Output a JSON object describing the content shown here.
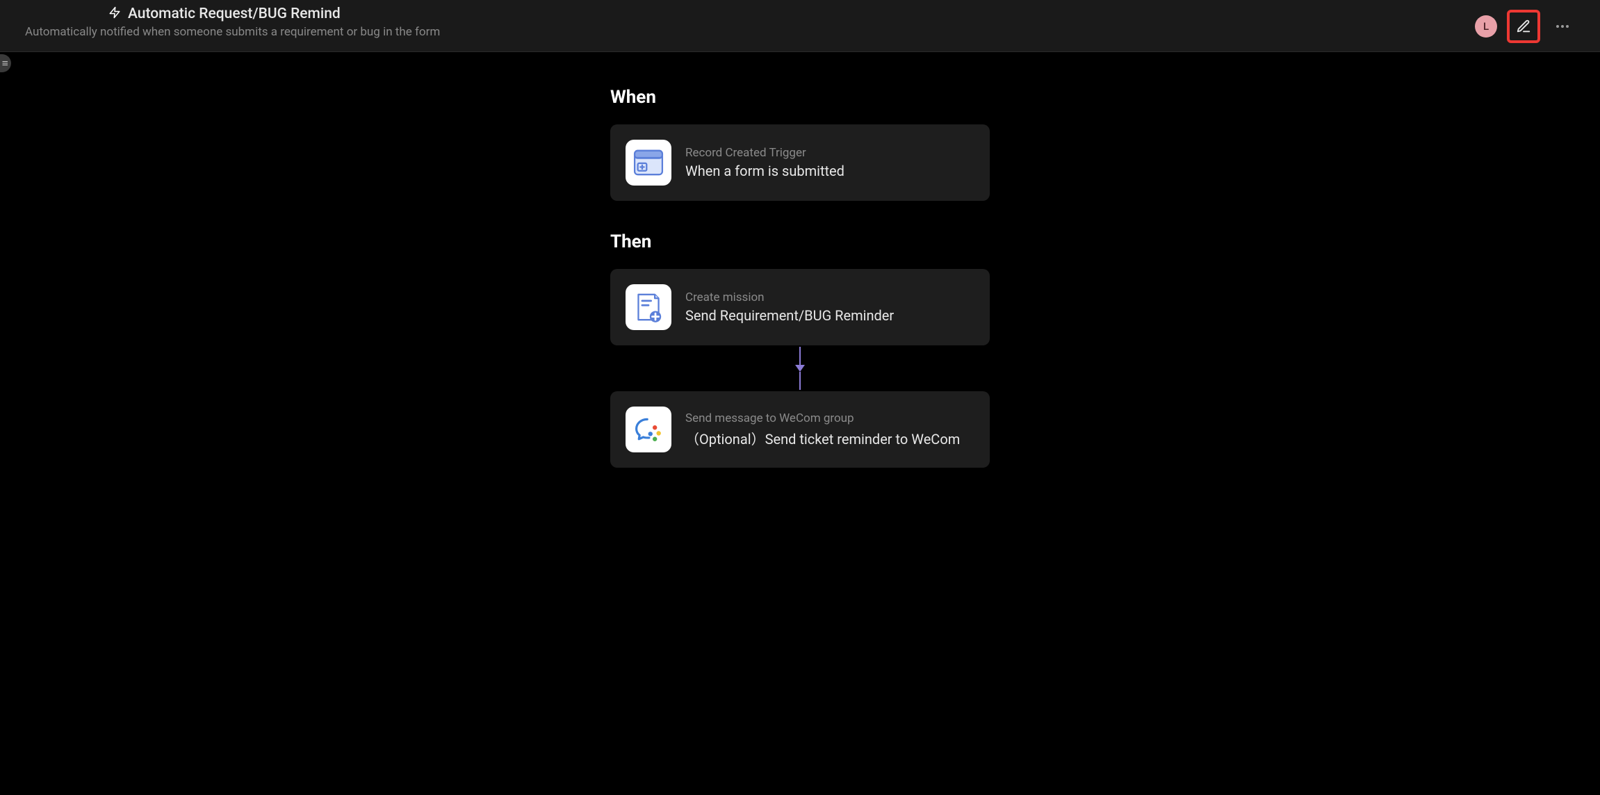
{
  "header": {
    "title": "Automatic Request/BUG Remind",
    "subtitle": "Automatically notified when someone submits a requirement or bug in the form",
    "avatar_initial": "L"
  },
  "sections": {
    "when": {
      "heading": "When",
      "card": {
        "label": "Record Created Trigger",
        "title": "When a form is submitted"
      }
    },
    "then": {
      "heading": "Then",
      "cards": [
        {
          "label": "Create mission",
          "title": "Send Requirement/BUG Reminder"
        },
        {
          "label": "Send message to WeCom group",
          "title": "（Optional）Send ticket reminder to WeCom"
        }
      ]
    }
  },
  "colors": {
    "highlight": "#ed3833",
    "connector": "#8b7bd6",
    "avatar_bg": "#e8a0a8"
  }
}
